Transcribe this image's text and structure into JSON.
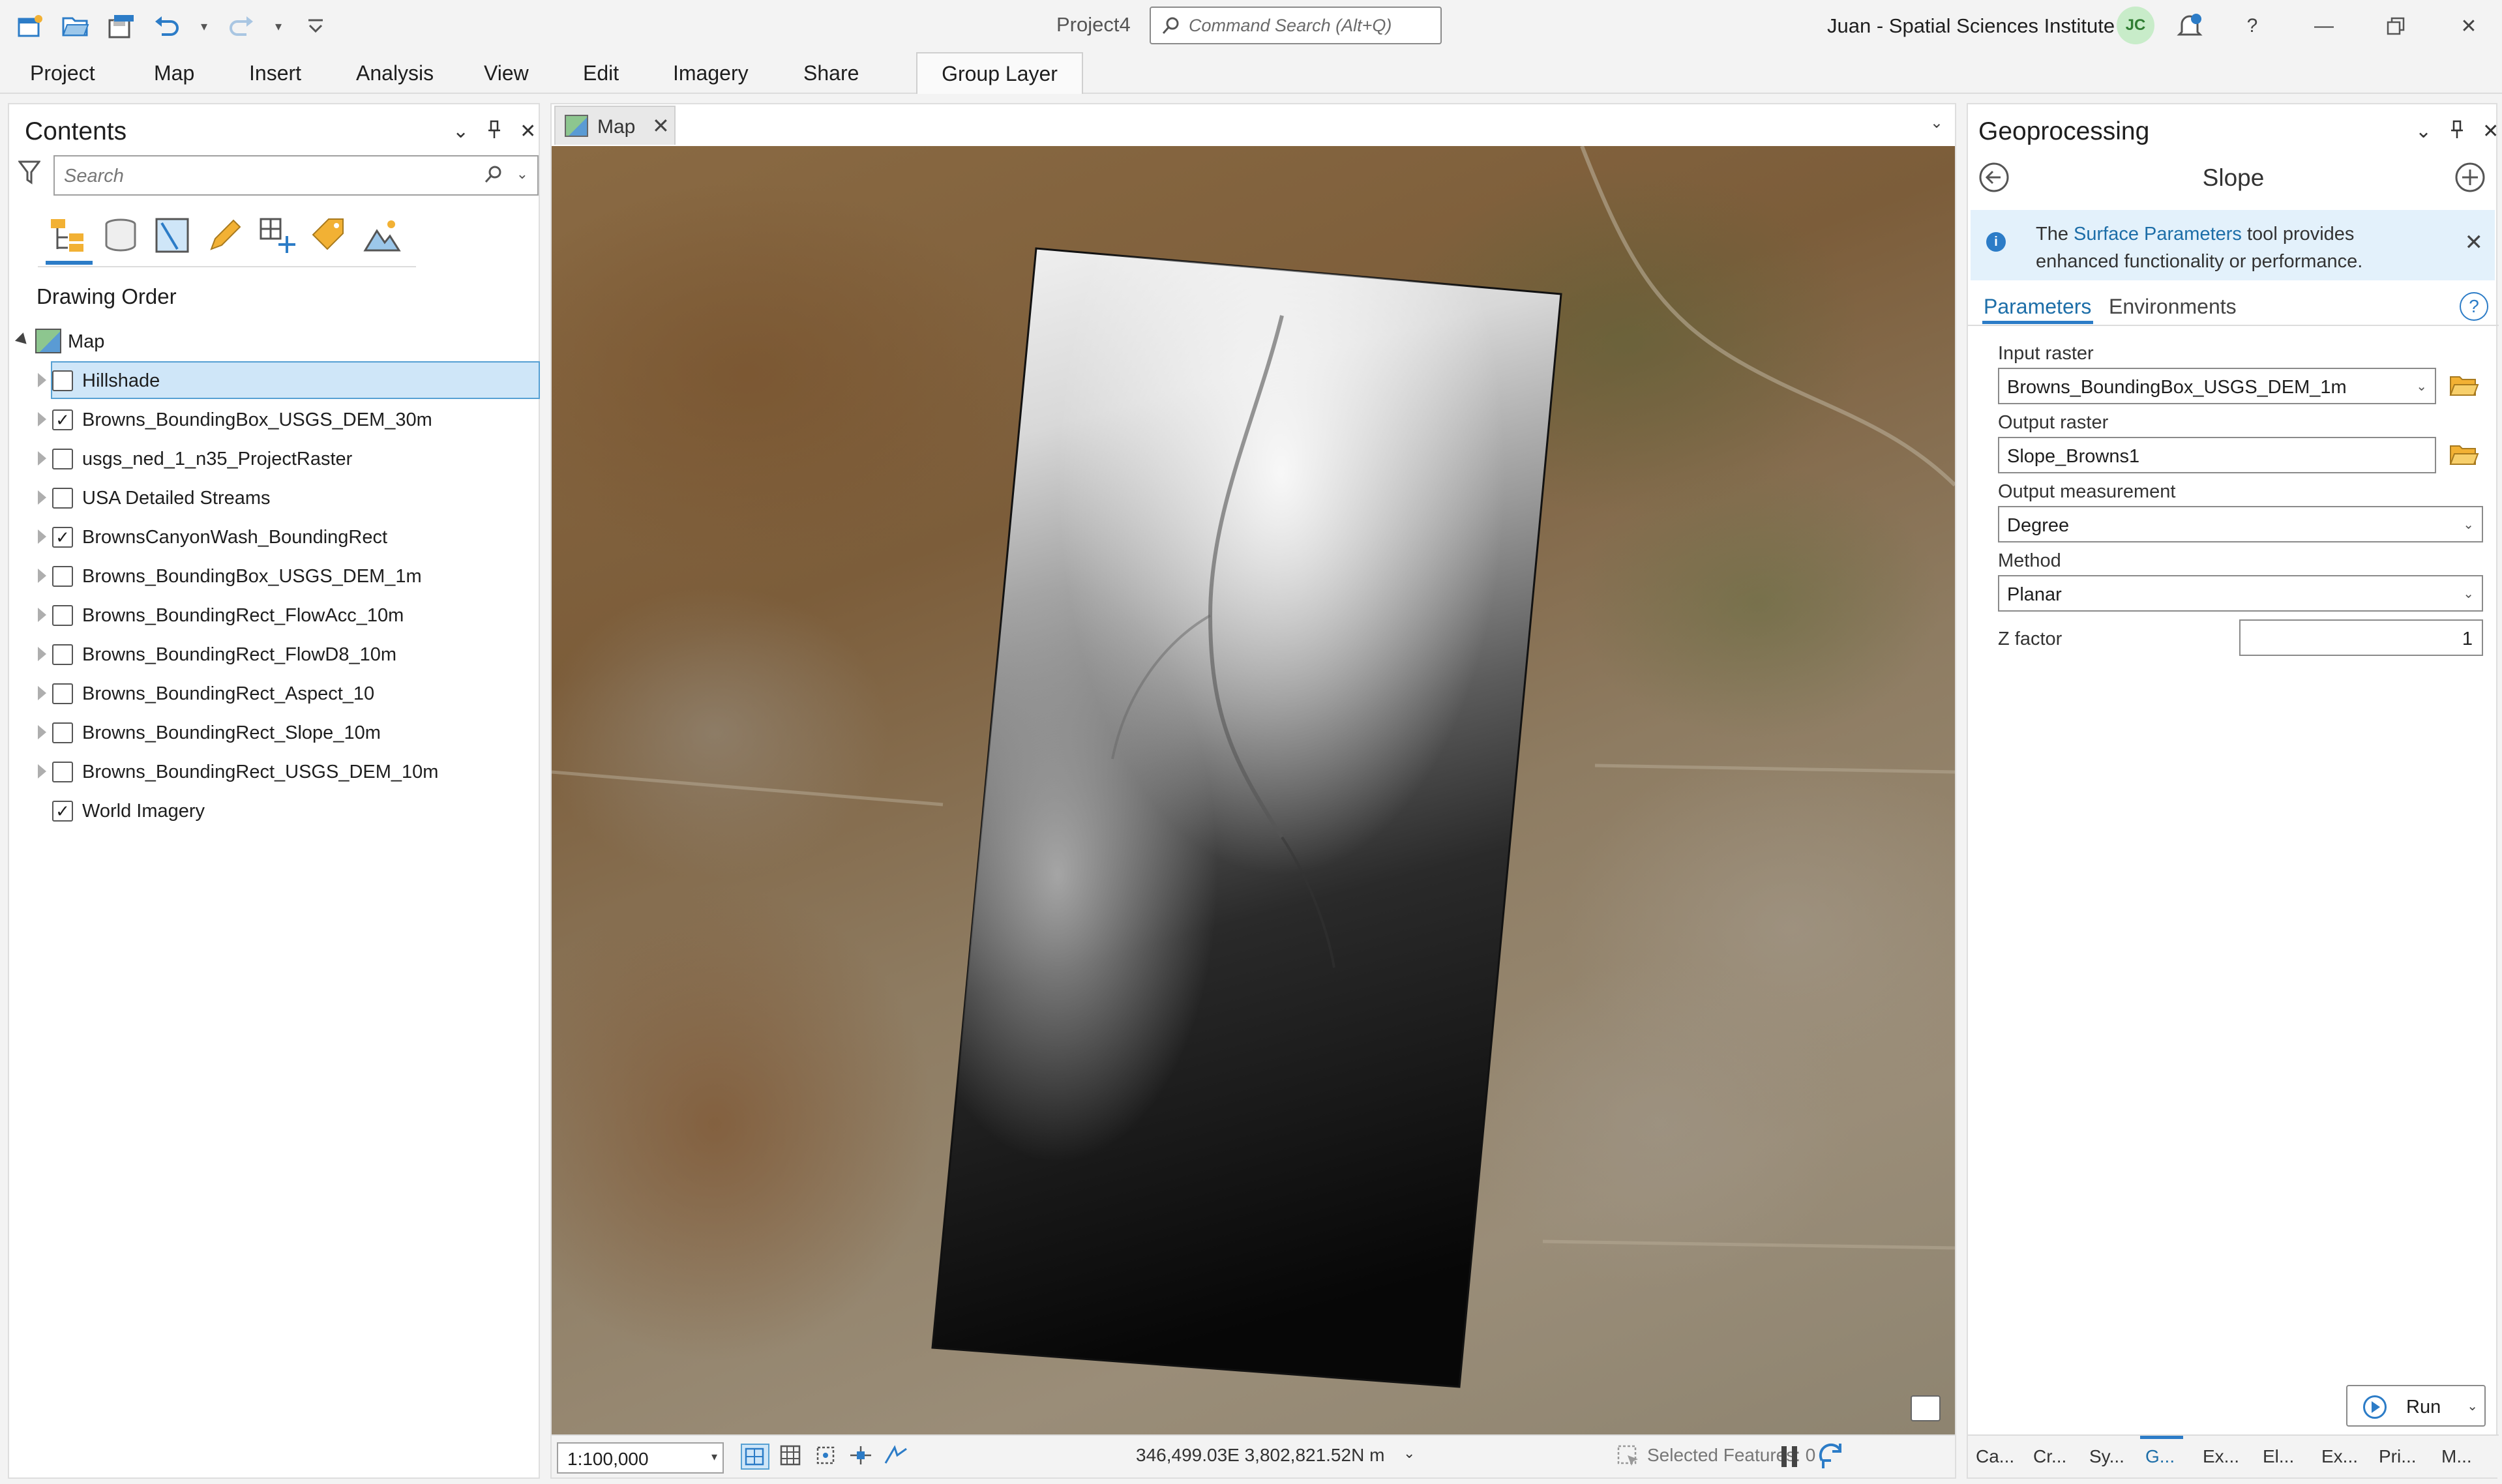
{
  "window": {
    "project_name": "Project4",
    "command_search_placeholder": "Command Search (Alt+Q)",
    "user": "Juan - Spatial Sciences Institute",
    "avatar_initials": "JC"
  },
  "ribbon": {
    "tabs": [
      "Project",
      "Map",
      "Insert",
      "Analysis",
      "View",
      "Edit",
      "Imagery",
      "Share"
    ],
    "contextual_tab": "Group Layer"
  },
  "contents": {
    "title": "Contents",
    "search_placeholder": "Search",
    "section_label": "Drawing Order",
    "map_node": "Map",
    "layers": [
      {
        "name": "Hillshade",
        "checked": false,
        "selected": true
      },
      {
        "name": "Browns_BoundingBox_USGS_DEM_30m",
        "checked": true,
        "selected": false
      },
      {
        "name": "usgs_ned_1_n35_ProjectRaster",
        "checked": false,
        "selected": false
      },
      {
        "name": "USA Detailed Streams",
        "checked": false,
        "selected": false
      },
      {
        "name": "BrownsCanyonWash_BoundingRect",
        "checked": true,
        "selected": false
      },
      {
        "name": "Browns_BoundingBox_USGS_DEM_1m",
        "checked": false,
        "selected": false
      },
      {
        "name": "Browns_BoundingRect_FlowAcc_10m",
        "checked": false,
        "selected": false
      },
      {
        "name": "Browns_BoundingRect_FlowD8_10m",
        "checked": false,
        "selected": false
      },
      {
        "name": "Browns_BoundingRect_Aspect_10",
        "checked": false,
        "selected": false
      },
      {
        "name": "Browns_BoundingRect_Slope_10m",
        "checked": false,
        "selected": false
      },
      {
        "name": "Browns_BoundingRect_USGS_DEM_10m",
        "checked": false,
        "selected": false
      },
      {
        "name": "World Imagery",
        "checked": true,
        "selected": false,
        "no_expander": true
      }
    ]
  },
  "map": {
    "tab_label": "Map",
    "scale": "1:100,000",
    "coordinates": "346,499.03E 3,802,821.52N m",
    "selected_features": "Selected Features: 0"
  },
  "geoprocessing": {
    "title": "Geoprocessing",
    "tool": "Slope",
    "info_prefix": "The",
    "info_link": "Surface Parameters",
    "info_suffix": "tool provides enhanced functionality or performance.",
    "tab_parameters": "Parameters",
    "tab_environments": "Environments",
    "params": {
      "input_raster_label": "Input raster",
      "input_raster_value": "Browns_BoundingBox_USGS_DEM_1m",
      "output_raster_label": "Output raster",
      "output_raster_value": "Slope_Browns1",
      "output_measurement_label": "Output measurement",
      "output_measurement_value": "Degree",
      "method_label": "Method",
      "method_value": "Planar",
      "z_factor_label": "Z factor",
      "z_factor_value": "1"
    },
    "run_label": "Run",
    "bottom_tabs": [
      "Ca...",
      "Cr...",
      "Sy...",
      "G...",
      "Ex...",
      "El...",
      "Ex...",
      "Pri...",
      "M..."
    ],
    "active_bottom_tab": "G..."
  },
  "colors": {
    "accent": "#2c7cc7",
    "selection_bg": "#cfe6f8",
    "info_bg": "#e3f1fb"
  }
}
